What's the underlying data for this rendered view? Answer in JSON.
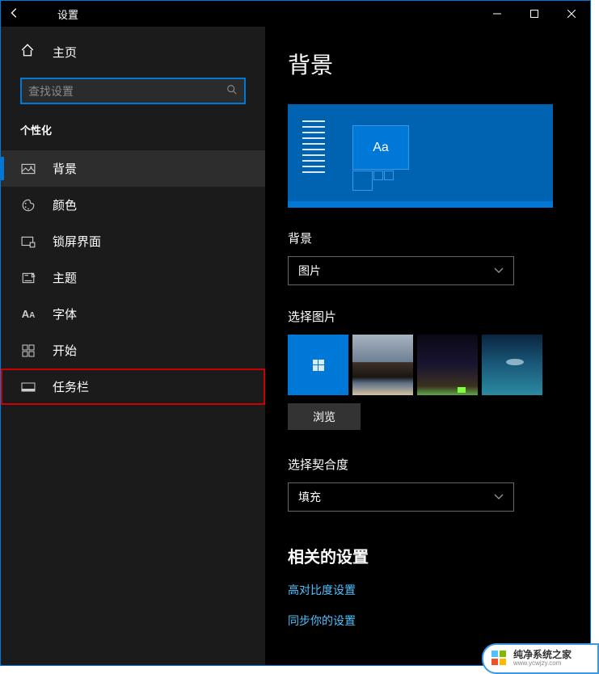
{
  "titlebar": {
    "title": "设置"
  },
  "sidebar": {
    "home": "主页",
    "search_placeholder": "查找设置",
    "section": "个性化",
    "items": [
      {
        "label": "背景"
      },
      {
        "label": "颜色"
      },
      {
        "label": "锁屏界面"
      },
      {
        "label": "主题"
      },
      {
        "label": "字体"
      },
      {
        "label": "开始"
      },
      {
        "label": "任务栏"
      }
    ]
  },
  "content": {
    "page_title": "背景",
    "bg_label": "背景",
    "bg_value": "图片",
    "choose_label": "选择图片",
    "browse": "浏览",
    "fit_label": "选择契合度",
    "fit_value": "填充",
    "related_title": "相关的设置",
    "link_contrast": "高对比度设置",
    "link_sync": "同步你的设置"
  },
  "watermark": {
    "zh": "纯净系统之家",
    "en": "www.ycwjzy.com"
  }
}
